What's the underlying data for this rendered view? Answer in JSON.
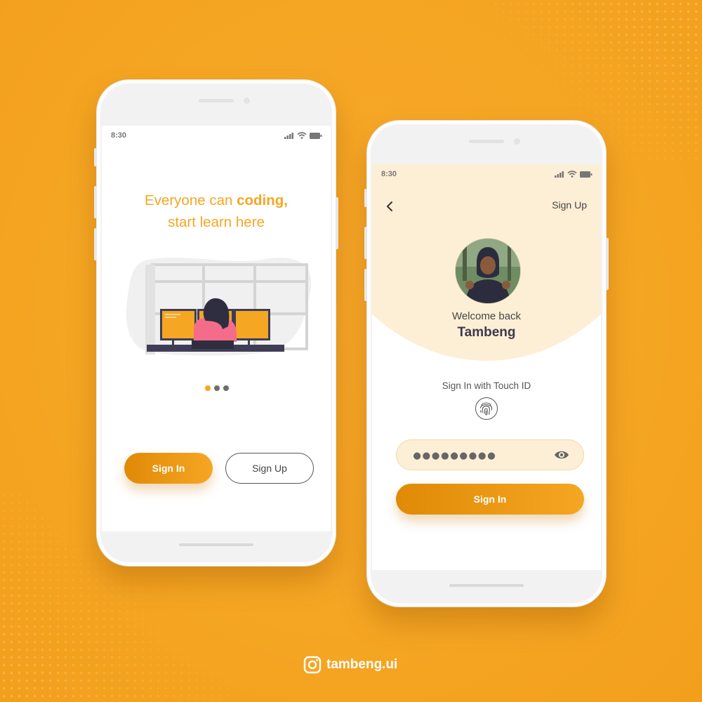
{
  "colors": {
    "background": "#f5a623",
    "accent": "#f5a623",
    "accent_dark": "#e08a06",
    "hero": "#fdefd5"
  },
  "onboarding": {
    "status_time": "8:30",
    "headline_pre": "Everyone can ",
    "headline_bold": "coding,",
    "headline_line2": "start learn here",
    "pager": {
      "total": 3,
      "active": 1
    },
    "sign_in_label": "Sign In",
    "sign_up_label": "Sign Up"
  },
  "login": {
    "status_time": "8:30",
    "sign_up_link": "Sign Up",
    "welcome_text": "Welcome back",
    "user_name": "Tambeng",
    "touch_id_label": "Sign In with Touch ID",
    "password_value": "●●●●●●●●●",
    "sign_in_label": "Sign In"
  },
  "footer": {
    "instagram_handle": "tambeng.ui"
  },
  "icons": [
    "signal-icon",
    "wifi-icon",
    "battery-icon",
    "back-chevron-icon",
    "fingerprint-icon",
    "eye-icon",
    "instagram-icon"
  ]
}
